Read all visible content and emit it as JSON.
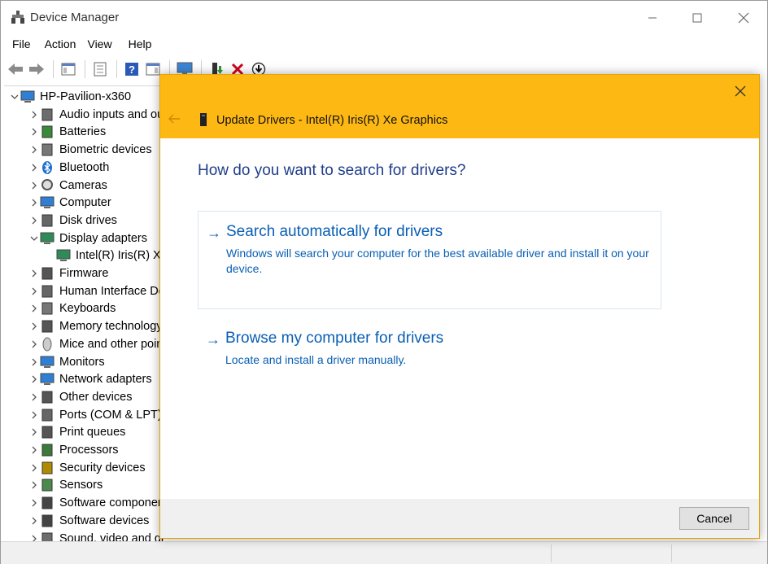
{
  "window": {
    "title": "Device Manager"
  },
  "menu": [
    "File",
    "Action",
    "View",
    "Help"
  ],
  "tree": {
    "root": "HP-Pavilion-x360",
    "items": [
      {
        "label": "Audio inputs and outputs",
        "icon": "speaker-icon",
        "expanded": false,
        "level": 1
      },
      {
        "label": "Batteries",
        "icon": "battery-icon",
        "expanded": false,
        "level": 1
      },
      {
        "label": "Biometric devices",
        "icon": "fingerprint-icon",
        "expanded": false,
        "level": 1
      },
      {
        "label": "Bluetooth",
        "icon": "bluetooth-icon",
        "expanded": false,
        "level": 1
      },
      {
        "label": "Cameras",
        "icon": "camera-icon",
        "expanded": false,
        "level": 1
      },
      {
        "label": "Computer",
        "icon": "monitor-icon",
        "expanded": false,
        "level": 1
      },
      {
        "label": "Disk drives",
        "icon": "disk-icon",
        "expanded": false,
        "level": 1
      },
      {
        "label": "Display adapters",
        "icon": "display-adapter-icon",
        "expanded": true,
        "level": 1
      },
      {
        "label": "Intel(R) Iris(R) Xe Graphics",
        "icon": "display-adapter-icon",
        "expanded": null,
        "level": 2
      },
      {
        "label": "Firmware",
        "icon": "chip-icon",
        "expanded": false,
        "level": 1
      },
      {
        "label": "Human Interface Devices",
        "icon": "hid-icon",
        "expanded": false,
        "level": 1
      },
      {
        "label": "Keyboards",
        "icon": "keyboard-icon",
        "expanded": false,
        "level": 1
      },
      {
        "label": "Memory technology devices",
        "icon": "memory-icon",
        "expanded": false,
        "level": 1
      },
      {
        "label": "Mice and other pointing devices",
        "icon": "mouse-icon",
        "expanded": false,
        "level": 1
      },
      {
        "label": "Monitors",
        "icon": "monitor-icon",
        "expanded": false,
        "level": 1
      },
      {
        "label": "Network adapters",
        "icon": "network-icon",
        "expanded": false,
        "level": 1
      },
      {
        "label": "Other devices",
        "icon": "unknown-device-icon",
        "expanded": false,
        "level": 1
      },
      {
        "label": "Ports (COM & LPT)",
        "icon": "port-icon",
        "expanded": false,
        "level": 1
      },
      {
        "label": "Print queues",
        "icon": "printer-icon",
        "expanded": false,
        "level": 1
      },
      {
        "label": "Processors",
        "icon": "processor-icon",
        "expanded": false,
        "level": 1
      },
      {
        "label": "Security devices",
        "icon": "security-icon",
        "expanded": false,
        "level": 1
      },
      {
        "label": "Sensors",
        "icon": "sensor-icon",
        "expanded": false,
        "level": 1
      },
      {
        "label": "Software components",
        "icon": "software-icon",
        "expanded": false,
        "level": 1
      },
      {
        "label": "Software devices",
        "icon": "software-icon",
        "expanded": false,
        "level": 1
      },
      {
        "label": "Sound, video and game controllers",
        "icon": "speaker-icon",
        "expanded": false,
        "level": 1
      }
    ]
  },
  "dialog": {
    "title": "Update Drivers - Intel(R) Iris(R) Xe Graphics",
    "heading": "How do you want to search for drivers?",
    "options": [
      {
        "title": "Search automatically for drivers",
        "description": "Windows will search your computer for the best available driver and install it on your device."
      },
      {
        "title": "Browse my computer for drivers",
        "description": "Locate and install a driver manually."
      }
    ],
    "cancel_label": "Cancel"
  },
  "colors": {
    "dialog_header": "#fdb813",
    "link_blue": "#0a5fb4",
    "heading_blue": "#1f3d8a"
  }
}
